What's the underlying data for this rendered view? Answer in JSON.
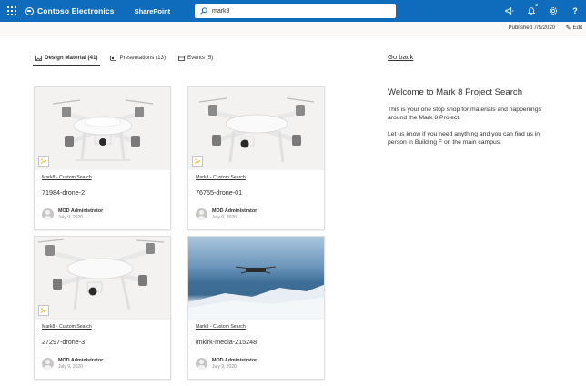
{
  "suitebar": {
    "company": "Contoso Electronics",
    "app": "SharePoint",
    "search": {
      "value": "mark8",
      "placeholder": ""
    },
    "icons": [
      "megaphone-icon",
      "notification-bell-icon",
      "gear-icon",
      "help-icon"
    ],
    "notification_badge": "2",
    "background_color": "#0f6cbd"
  },
  "commandbar": {
    "published": "Published 7/9/2020",
    "edit_label": "Edit"
  },
  "tabs": [
    {
      "label": "Design Material (41)",
      "icon": "image-icon",
      "active": true
    },
    {
      "label": "Presentations (13)",
      "icon": "presentation-icon",
      "active": false
    },
    {
      "label": "Events (5)",
      "icon": "calendar-icon",
      "active": false
    }
  ],
  "cards": [
    {
      "site": "Mark8 - Custom Search",
      "title": "71984-drone-2",
      "author": "MOD Administrator",
      "date": "July 9, 2020"
    },
    {
      "site": "Mark8 - Custom Search",
      "title": "76755-drone-01",
      "author": "MOD Administrator",
      "date": "July 9, 2020"
    },
    {
      "site": "Mark8 - Custom Search",
      "title": "27297-drone-3",
      "author": "MOD Administrator",
      "date": "July 9, 2020"
    },
    {
      "site": "Mark8 - Custom Search",
      "title": "imkirk-media-215248",
      "author": "MOD Administrator",
      "date": "July 9, 2020"
    }
  ],
  "sidebar": {
    "go_back": "Go back",
    "title": "Welcome to Mark 8 Project Search",
    "paragraph1": "This is your one stop shop for materials and happenings around the Mark 8 Project.",
    "paragraph2": "Let us know if you need anything and you can find us in person in Building F on the main campus."
  }
}
